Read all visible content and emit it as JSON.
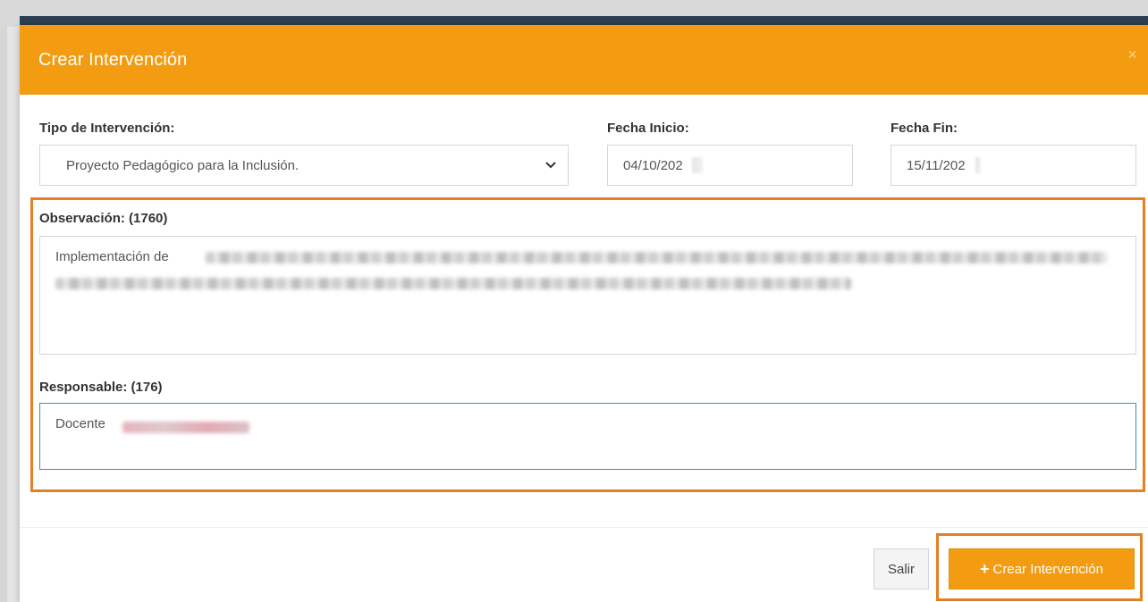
{
  "modal": {
    "title": "Crear Intervención",
    "close_symbol": "×"
  },
  "form": {
    "tipo": {
      "label": "Tipo de Intervención:",
      "selected": "Proyecto Pedagógico para la Inclusión."
    },
    "fecha_inicio": {
      "label": "Fecha Inicio:",
      "value": "04/10/202"
    },
    "fecha_fin": {
      "label": "Fecha Fin:",
      "value": "15/11/202"
    },
    "observacion": {
      "label": "Observación: (1760)",
      "value": "Implementación de"
    },
    "responsable": {
      "label": "Responsable: (176)",
      "value": "Docente"
    }
  },
  "footer": {
    "salir_label": "Salir",
    "crear_label": "Crear Intervención",
    "crear_icon": "plus-icon"
  },
  "colors": {
    "header": "#f39c12",
    "highlight": "#e67e22",
    "focus_border": "#3c8dbc"
  }
}
